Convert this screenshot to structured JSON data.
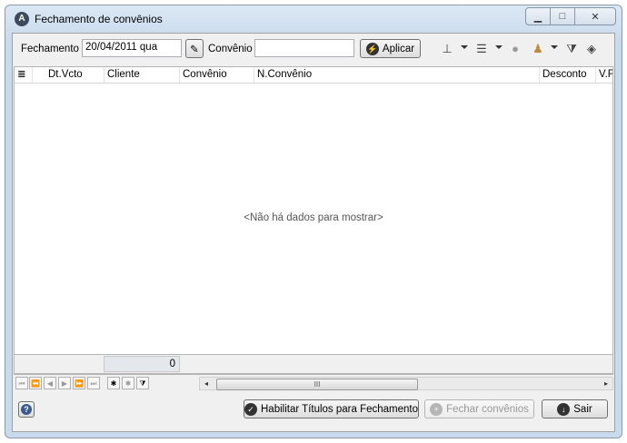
{
  "window": {
    "title": "Fechamento de convênios",
    "minimize_icon": "minimize-icon",
    "maximize_icon": "maximize-icon",
    "close_icon": "close-icon"
  },
  "toolbar": {
    "fechamento_label": "Fechamento",
    "fechamento_value": "20/04/2011 qua",
    "convenio_label": "Convênio",
    "convenio_value": "",
    "aplicar_label": "Aplicar"
  },
  "grid": {
    "columns": [
      "",
      "Dt.Vcto",
      "Cliente",
      "Convênio",
      "N.Convênio",
      "Desconto",
      "V.F"
    ],
    "empty_message": "<Não há dados para mostrar>",
    "footer_total": "0"
  },
  "scrollbar": {
    "thumb_label": "III"
  },
  "buttons": {
    "habilitar_label": "Habilitar Títulos para Fechamento",
    "fechar_label": "Fechar convênios",
    "sair_label": "Sair"
  },
  "colors": {
    "window_chrome": "#c9daec",
    "client_bg": "#f0f0f0",
    "grid_bg": "#ffffff"
  }
}
